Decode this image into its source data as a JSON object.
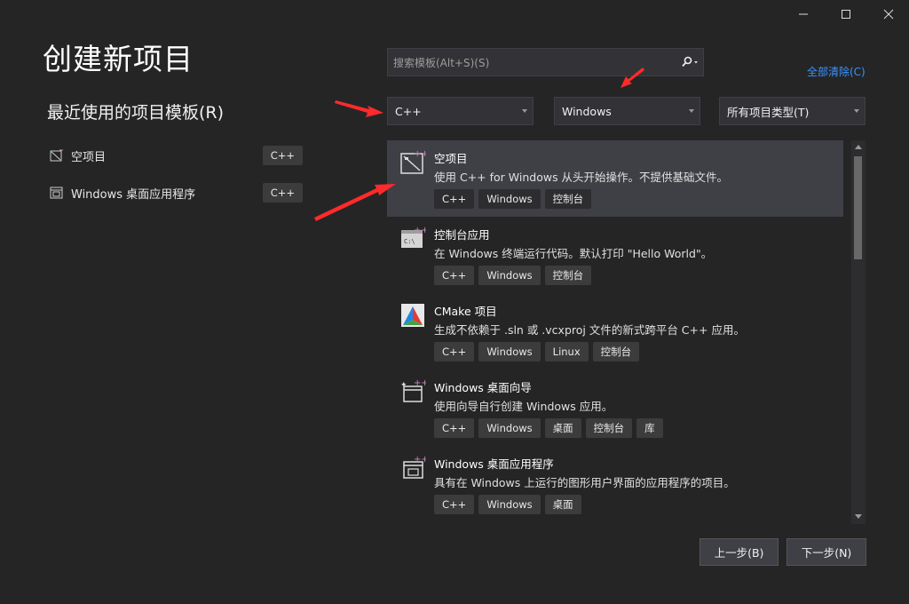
{
  "window": {
    "controls": [
      "minimize",
      "maximize",
      "close"
    ]
  },
  "page_title": "创建新项目",
  "recent": {
    "heading": "最近使用的项目模板(R)",
    "items": [
      {
        "label": "空项目",
        "tag": "C++",
        "icon": "empty-project-icon"
      },
      {
        "label": "Windows 桌面应用程序",
        "tag": "C++",
        "icon": "windows-desktop-app-icon"
      }
    ]
  },
  "search": {
    "placeholder": "搜索模板(Alt+S)(S)",
    "value": ""
  },
  "clear_all": "全部清除(C)",
  "filters": {
    "language": "C++",
    "platform": "Windows",
    "project_type": "所有项目类型(T)"
  },
  "templates": [
    {
      "name": "空项目",
      "description": "使用 C++ for Windows 从头开始操作。不提供基础文件。",
      "tags": [
        "C++",
        "Windows",
        "控制台"
      ],
      "icon": "empty-project-icon",
      "selected": true
    },
    {
      "name": "控制台应用",
      "description": "在 Windows 终端运行代码。默认打印 \"Hello World\"。",
      "tags": [
        "C++",
        "Windows",
        "控制台"
      ],
      "icon": "console-app-icon",
      "selected": false
    },
    {
      "name": "CMake 项目",
      "description": "生成不依赖于 .sln 或 .vcxproj 文件的新式跨平台 C++ 应用。",
      "tags": [
        "C++",
        "Windows",
        "Linux",
        "控制台"
      ],
      "icon": "cmake-icon",
      "selected": false
    },
    {
      "name": "Windows 桌面向导",
      "description": "使用向导自行创建 Windows 应用。",
      "tags": [
        "C++",
        "Windows",
        "桌面",
        "控制台",
        "库"
      ],
      "icon": "desktop-wizard-icon",
      "selected": false
    },
    {
      "name": "Windows 桌面应用程序",
      "description": "具有在 Windows 上运行的图形用户界面的应用程序的项目。",
      "tags": [
        "C++",
        "Windows",
        "桌面"
      ],
      "icon": "windows-desktop-app-icon",
      "selected": false
    }
  ],
  "buttons": {
    "back": "上一步(B)",
    "next": "下一步(N)"
  },
  "colors": {
    "background": "#252526",
    "selected_row": "#3f3f46",
    "link": "#3794ff",
    "annotation_arrow": "#ff2a2a"
  }
}
